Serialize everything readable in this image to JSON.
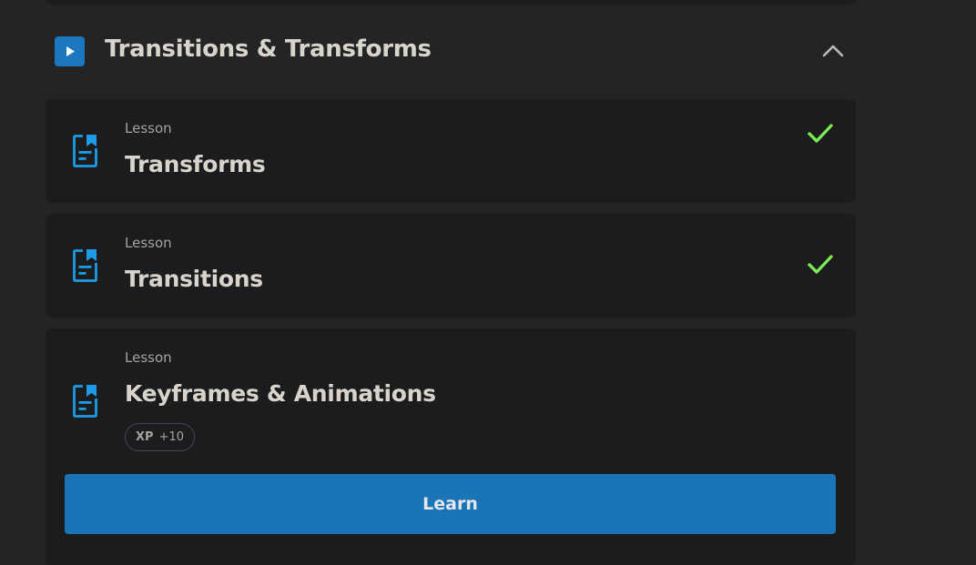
{
  "section": {
    "title": "Transitions & Transforms",
    "icon": "play-icon",
    "toggle_icon": "chevron-up-icon"
  },
  "lessons": [
    {
      "type": "Lesson",
      "title": "Transforms",
      "icon": "document-bookmark-icon",
      "completed": true
    },
    {
      "type": "Lesson",
      "title": "Transitions",
      "icon": "document-bookmark-icon",
      "completed": true
    },
    {
      "type": "Lesson",
      "title": "Keyframes & Animations",
      "icon": "document-bookmark-icon",
      "completed": false,
      "xp_label": "XP",
      "xp_value": "+10",
      "action_label": "Learn"
    }
  ],
  "colors": {
    "background": "#232425",
    "card": "#1b1c1e",
    "accent": "#1b74b6",
    "icon_blue": "#1e9be6",
    "check_green": "#7be854",
    "text_primary": "#d8d3cb",
    "text_secondary": "#a7a39c"
  }
}
